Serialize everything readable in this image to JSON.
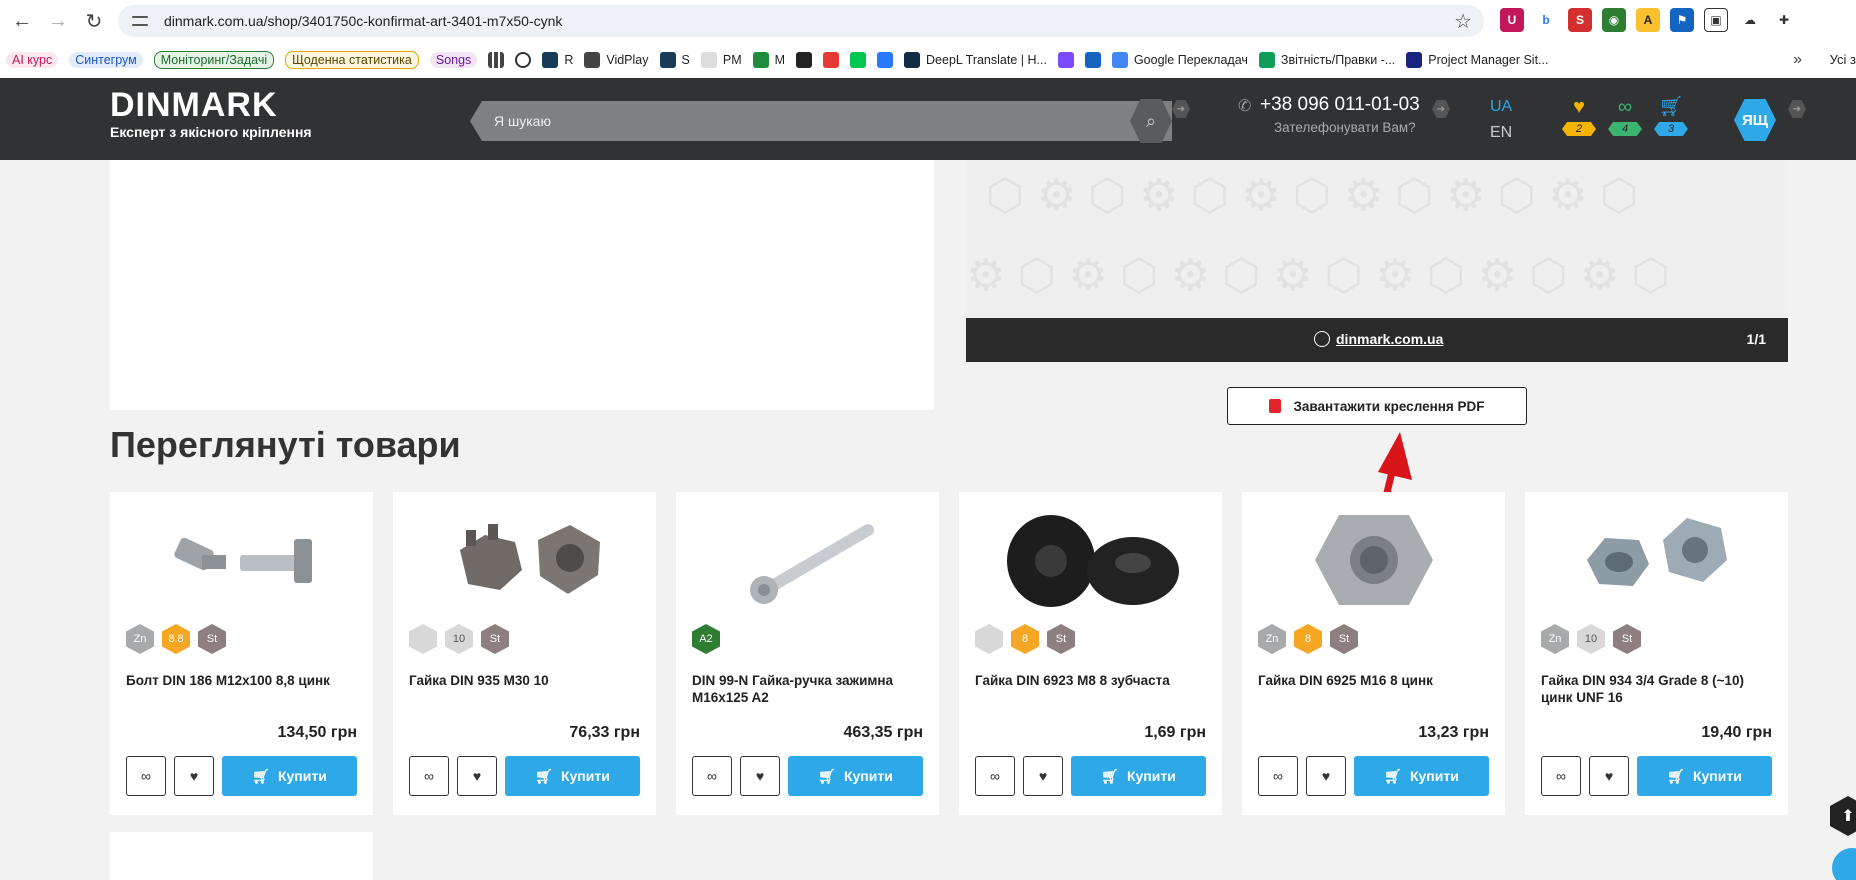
{
  "browser": {
    "url": "dinmark.com.ua/shop/3401750c-konfirmat-art-3401-m7x50-cynk",
    "bookmarks": [
      {
        "label": "AI курс",
        "style": "chip",
        "color": "#c2185b",
        "bg": "#fde7ef"
      },
      {
        "label": "Синтегрум",
        "style": "chip",
        "color": "#1a56c4",
        "bg": "#e3ecfb"
      },
      {
        "label": "Моніторинг/Задачі",
        "style": "chip",
        "color": "#1e6b2e",
        "bg": "#e6f4e8",
        "border": "#2e7d32"
      },
      {
        "label": "Щоденна статистика",
        "style": "chip",
        "color": "#5a4400",
        "bg": "#fff8e1",
        "border": "#e0a800"
      },
      {
        "label": "Songs",
        "style": "chip",
        "color": "#6a1b9a",
        "bg": "#f3e5f5"
      },
      {
        "label": "",
        "icon": "grid"
      },
      {
        "label": "",
        "icon": "openai"
      },
      {
        "label": "R",
        "fav": "#1b3b5a"
      },
      {
        "label": "VidPlay",
        "fav": "#444"
      },
      {
        "label": "S",
        "fav": "#1b3b5a"
      },
      {
        "label": "PM",
        "fav": "#ddd"
      },
      {
        "label": "M",
        "fav": "#1e8e3e"
      },
      {
        "label": "",
        "fav": "#222"
      },
      {
        "label": "",
        "fav": "#e53935"
      },
      {
        "label": "",
        "fav": "#00c853"
      },
      {
        "label": "",
        "fav": "#2979ff"
      },
      {
        "label": "DeepL Translate | Н...",
        "fav": "#0f2b46"
      },
      {
        "label": "",
        "fav": "#7c4dff"
      },
      {
        "label": "",
        "fav": "#1565c0"
      },
      {
        "label": "Google Перекладач",
        "fav": "#4285f4"
      },
      {
        "label": "Звітність/Правки -...",
        "fav": "#0f9d58"
      },
      {
        "label": "Project Manager Sit...",
        "fav": "#1a237e"
      }
    ],
    "more": "»",
    "folder": "Усі з"
  },
  "header": {
    "logo_word": "DINMARK",
    "logo_tag": "Експерт з якісного кріплення",
    "search_placeholder": "Я шукаю",
    "phone": "+38 096 011-01-03",
    "callback": "Зателефонувати Вам?",
    "lang_ua": "UA",
    "lang_en": "EN",
    "favorites_count": "2",
    "compare_count": "4",
    "cart_count": "3",
    "avatar": "ЯЩ",
    "colors": {
      "fav": "#f5b400",
      "compare": "#3cb371",
      "cart": "#2ea8e6"
    }
  },
  "drawing": {
    "site": "dinmark.com.ua",
    "counter": "1/1",
    "pdf_button": "Завантажити креслення PDF"
  },
  "viewed": {
    "title": "Переглянуті товари",
    "buy_label": "Купити",
    "products": [
      {
        "name": "Болт DIN 186 M12x100 8,8 цинк",
        "price": "134,50 грн",
        "badges": [
          {
            "t": "Zn",
            "c": "#a7a9ab"
          },
          {
            "t": "8.8",
            "c": "#f5a623"
          },
          {
            "t": "St",
            "c": "#8d7f7f",
            "dark": true
          }
        ],
        "image": "t-bolt"
      },
      {
        "name": "Гайка DIN 935 M30 10",
        "price": "76,33 грн",
        "badges": [
          {
            "t": "",
            "c": "#d8d8d8"
          },
          {
            "t": "10",
            "c": "#d8d8d8",
            "light": true
          },
          {
            "t": "St",
            "c": "#8d7f7f",
            "dark": true
          }
        ],
        "image": "castle-nut"
      },
      {
        "name": "DIN 99-N Гайка-ручка зажимна M16x125 A2",
        "price": "463,35 грн",
        "badges": [
          {
            "t": "A2",
            "c": "#2e7d32"
          }
        ],
        "image": "handle"
      },
      {
        "name": "Гайка DIN 6923 M8 8 зубчаста",
        "price": "1,69 грн",
        "badges": [
          {
            "t": "",
            "c": "#d8d8d8"
          },
          {
            "t": "8",
            "c": "#f5a623"
          },
          {
            "t": "St",
            "c": "#8d7f7f",
            "dark": true
          }
        ],
        "image": "flange-nut"
      },
      {
        "name": "Гайка DIN 6925 M16 8 цинк",
        "price": "13,23 грн",
        "badges": [
          {
            "t": "Zn",
            "c": "#a7a9ab"
          },
          {
            "t": "8",
            "c": "#f5a623"
          },
          {
            "t": "St",
            "c": "#8d7f7f",
            "dark": true
          }
        ],
        "image": "lock-nut"
      },
      {
        "name": "Гайка DIN 934 3/4 Grade 8 (~10) цинк UNF 16",
        "price": "19,40 грн",
        "badges": [
          {
            "t": "Zn",
            "c": "#a7a9ab"
          },
          {
            "t": "10",
            "c": "#d8d8d8",
            "light": true
          },
          {
            "t": "St",
            "c": "#8d7f7f",
            "dark": true
          }
        ],
        "image": "hex-nuts"
      }
    ]
  }
}
